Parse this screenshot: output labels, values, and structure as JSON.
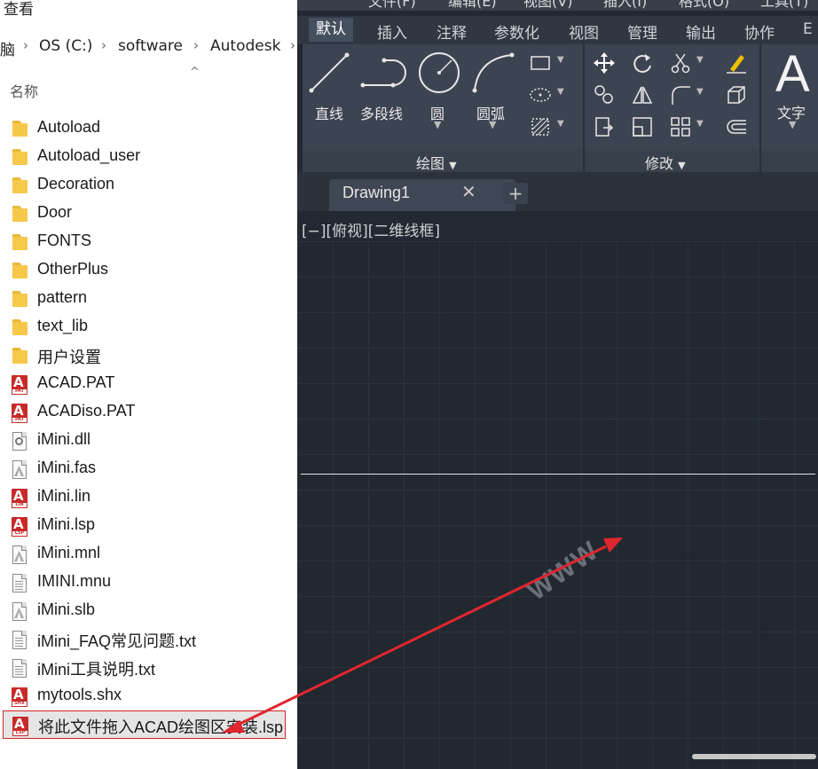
{
  "explorer": {
    "toolbar_tab": "查看",
    "breadcrumb": [
      "脑",
      "OS (C:)",
      "software",
      "Autodesk"
    ],
    "column_header": "名称",
    "files": [
      {
        "name": "Autoload",
        "type": "folder"
      },
      {
        "name": "Autoload_user",
        "type": "folder"
      },
      {
        "name": "Decoration",
        "type": "folder"
      },
      {
        "name": "Door",
        "type": "folder"
      },
      {
        "name": "FONTS",
        "type": "folder"
      },
      {
        "name": "OtherPlus",
        "type": "folder"
      },
      {
        "name": "pattern",
        "type": "folder"
      },
      {
        "name": "text_lib",
        "type": "folder"
      },
      {
        "name": "用户设置",
        "type": "folder"
      },
      {
        "name": "ACAD.PAT",
        "type": "cad",
        "tag": "PAT"
      },
      {
        "name": "ACADiso.PAT",
        "type": "cad",
        "tag": "PAT"
      },
      {
        "name": "iMini.dll",
        "type": "dll"
      },
      {
        "name": "iMini.fas",
        "type": "doc-wm"
      },
      {
        "name": "iMini.lin",
        "type": "cad",
        "tag": "LIN"
      },
      {
        "name": "iMini.lsp",
        "type": "cad",
        "tag": "LSP"
      },
      {
        "name": "iMini.mnl",
        "type": "doc-wm"
      },
      {
        "name": "IMINI.mnu",
        "type": "doc"
      },
      {
        "name": "iMini.slb",
        "type": "doc-wm"
      },
      {
        "name": "iMini_FAQ常见问题.txt",
        "type": "txt"
      },
      {
        "name": "iMini工具说明.txt",
        "type": "txt"
      },
      {
        "name": "mytools.shx",
        "type": "cad",
        "tag": "SHX"
      },
      {
        "name": "将此文件拖入ACAD绘图区安装.lsp",
        "type": "cad",
        "tag": "LSP",
        "selected": true
      }
    ]
  },
  "cad": {
    "menu": [
      "文件(F)",
      "编辑(E)",
      "视图(V)",
      "插入(I)",
      "格式(O)",
      "工具(T)"
    ],
    "ribbon_tabs": [
      "默认",
      "插入",
      "注释",
      "参数化",
      "视图",
      "管理",
      "输出",
      "协作",
      "E"
    ],
    "draw_tools": [
      "直线",
      "多段线",
      "圆",
      "圆弧"
    ],
    "text_tool": "文字",
    "panel_draw": "绘图",
    "panel_modify": "修改",
    "doc_tab": "Drawing1",
    "viewport_label": "[−][俯视][二维线框]",
    "watermark": "WWW"
  },
  "colors": {
    "annotation_arrow": "#e0262f",
    "cad_background": "#212830",
    "folder": "#f5c84a",
    "cad_icon": "#c82a2a"
  }
}
